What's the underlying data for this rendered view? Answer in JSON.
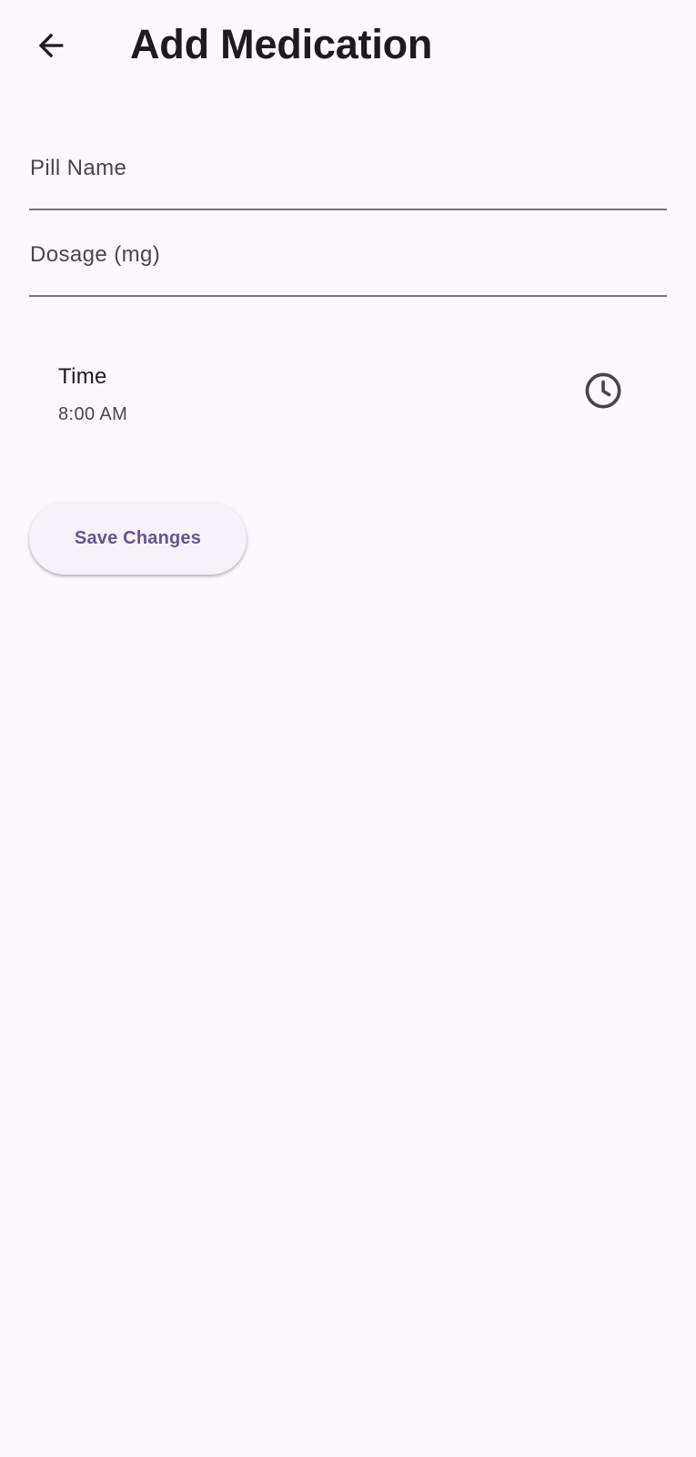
{
  "app_bar": {
    "title": "Add Medication",
    "back_icon": "arrow-back-icon"
  },
  "form": {
    "pill_name": {
      "label": "Pill Name",
      "value": ""
    },
    "dosage": {
      "label": "Dosage (mg)",
      "value": ""
    },
    "time": {
      "title": "Time",
      "value": "8:00 AM",
      "icon": "clock-icon"
    }
  },
  "actions": {
    "save_label": "Save Changes"
  },
  "colors": {
    "background": "#fdf7fe",
    "accent": "#65558f",
    "button_surface": "#f7f2f9",
    "text_primary": "#1d1b20",
    "text_secondary": "#49454f",
    "underline": "#79767d"
  }
}
